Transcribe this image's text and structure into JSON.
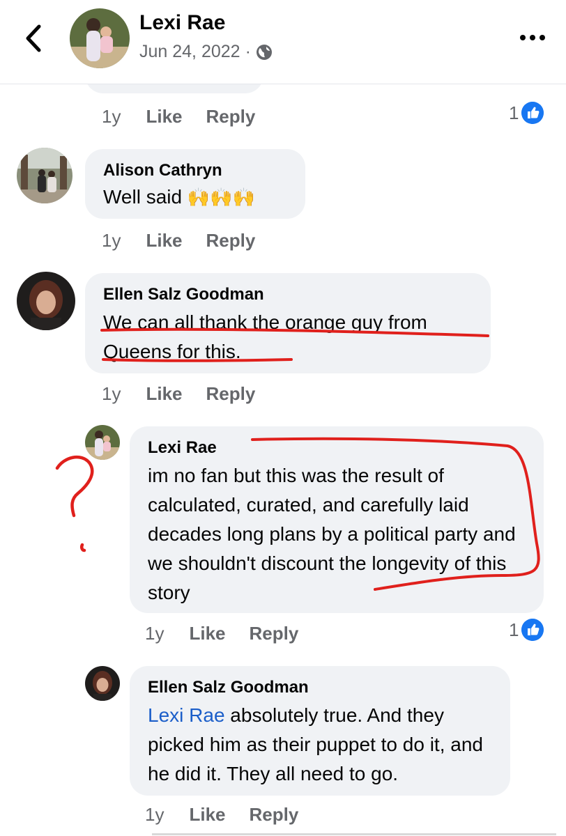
{
  "header": {
    "author": "Lexi Rae",
    "date": "Jun 24, 2022",
    "separator": "·",
    "icons": {
      "back": "chevron-left-icon",
      "privacy": "globe-icon",
      "menu": "more-options-icon"
    }
  },
  "comments": [
    {
      "age": "1y",
      "like_label": "Like",
      "reply_label": "Reply",
      "reaction_count": "1"
    },
    {
      "name": "Alison Cathryn",
      "text": "Well said",
      "emoji": "🙌🙌🙌",
      "age": "1y",
      "like_label": "Like",
      "reply_label": "Reply"
    },
    {
      "name": "Ellen Salz Goodman",
      "text": "We can all thank the orange guy from Queens for this.",
      "age": "1y",
      "like_label": "Like",
      "reply_label": "Reply"
    },
    {
      "name": "Lexi Rae",
      "text": "im no fan but this was the result of calculated, curated, and carefully laid decades long plans by a political party and we shouldn't discount the longevity of this story",
      "age": "1y",
      "like_label": "Like",
      "reply_label": "Reply",
      "reaction_count": "1"
    },
    {
      "name": "Ellen Salz Goodman",
      "mention": "Lexi Rae",
      "text": "absolutely true.  And they picked him as their puppet to do it, and he did it.  They all need to go.",
      "age": "1y",
      "like_label": "Like",
      "reply_label": "Reply"
    }
  ],
  "colors": {
    "bubble": "#f0f2f5",
    "meta_text": "#65676b",
    "mention": "#1b5ec9",
    "like_badge": "#1877f2",
    "annotation_ink": "#e0201c"
  },
  "annotations": [
    "red-underline",
    "red-underline",
    "red-bracket",
    "red-question-mark"
  ]
}
